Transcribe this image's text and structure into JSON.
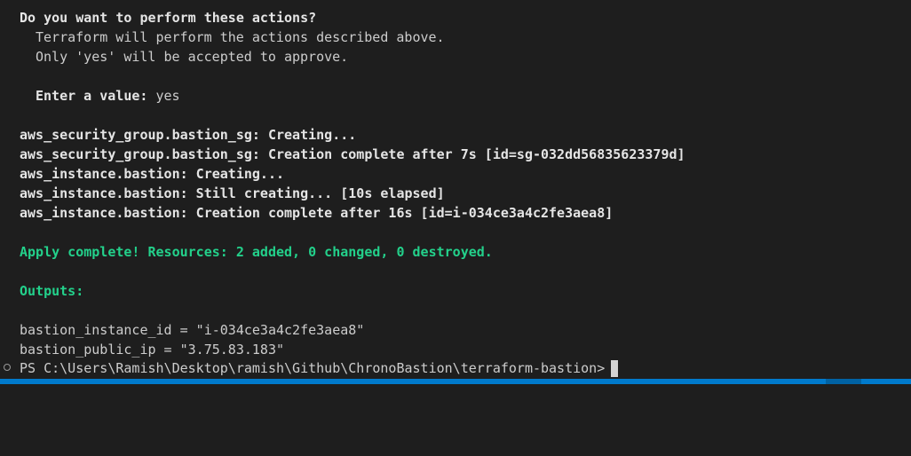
{
  "terminal": {
    "prompt_question": "Do you want to perform these actions?",
    "info_line_1": "Terraform will perform the actions described above.",
    "info_line_2": "Only 'yes' will be accepted to approve.",
    "enter_label": "Enter a value:",
    "enter_value": " yes",
    "log": [
      "aws_security_group.bastion_sg: Creating...",
      "aws_security_group.bastion_sg: Creation complete after 7s [id=sg-032dd56835623379d]",
      "aws_instance.bastion: Creating...",
      "aws_instance.bastion: Still creating... [10s elapsed]",
      "aws_instance.bastion: Creation complete after 16s [id=i-034ce3a4c2fe3aea8]"
    ],
    "apply_result": "Apply complete! Resources: 2 added, 0 changed, 0 destroyed.",
    "outputs_header": "Outputs:",
    "outputs": [
      "bastion_instance_id = \"i-034ce3a4c2fe3aea8\"",
      "bastion_public_ip = \"3.75.83.183\""
    ],
    "shell_prompt": "PS C:\\Users\\Ramish\\Desktop\\ramish\\Github\\ChronoBastion\\terraform-bastion>"
  },
  "colors": {
    "background": "#1e1e1e",
    "text": "#cccccc",
    "success_green": "#23d18b",
    "statusbar_blue": "#007acc"
  }
}
